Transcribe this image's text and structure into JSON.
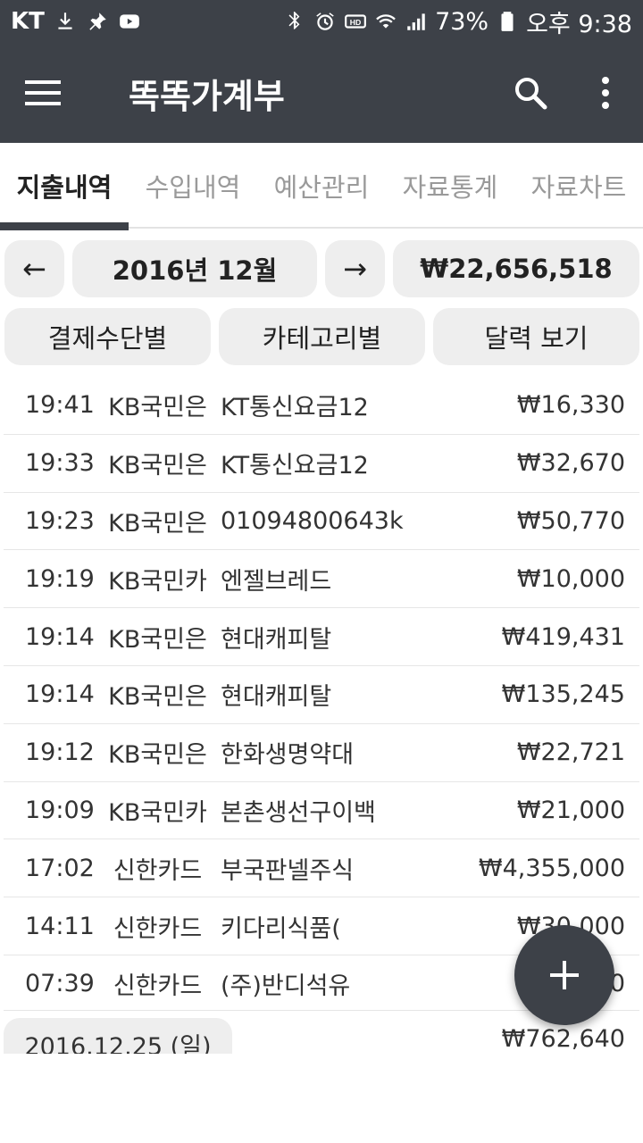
{
  "status_bar": {
    "carrier": "KT",
    "battery": "73%",
    "time": "오후 9:38",
    "icons": [
      "download-icon",
      "pin-icon",
      "youtube-icon",
      "bluetooth-icon",
      "alarm-icon",
      "hd-icon",
      "wifi-icon",
      "signal-icon",
      "battery-icon"
    ]
  },
  "appbar": {
    "title": "똑똑가계부",
    "icons": [
      "menu-icon",
      "search-icon",
      "more-vert-icon"
    ]
  },
  "tabs": [
    {
      "label": "지출내역",
      "active": true
    },
    {
      "label": "수입내역",
      "active": false
    },
    {
      "label": "예산관리",
      "active": false
    },
    {
      "label": "자료통계",
      "active": false
    },
    {
      "label": "자료차트",
      "active": false
    }
  ],
  "controls": {
    "prev": "←",
    "month": "2016년 12월",
    "next": "→",
    "total": "₩22,656,518",
    "by_payment": "결제수단별",
    "by_category": "카테고리별",
    "calendar": "달력 보기"
  },
  "transactions": [
    {
      "time": "19:41",
      "payment": "KB국민은",
      "desc": "KT통신요금12",
      "amount": "₩16,330"
    },
    {
      "time": "19:33",
      "payment": "KB국민은",
      "desc": "KT통신요금12",
      "amount": "₩32,670"
    },
    {
      "time": "19:23",
      "payment": "KB국민은",
      "desc": "01094800643k",
      "amount": "₩50,770"
    },
    {
      "time": "19:19",
      "payment": "KB국민카",
      "desc": "엔젤브레드",
      "amount": "₩10,000"
    },
    {
      "time": "19:14",
      "payment": "KB국민은",
      "desc": "현대캐피탈",
      "amount": "₩419,431"
    },
    {
      "time": "19:14",
      "payment": "KB국민은",
      "desc": "현대캐피탈",
      "amount": "₩135,245"
    },
    {
      "time": "19:12",
      "payment": "KB국민은",
      "desc": "한화생명약대",
      "amount": "₩22,721"
    },
    {
      "time": "19:09",
      "payment": "KB국민카",
      "desc": "본촌생선구이백",
      "amount": "₩21,000"
    },
    {
      "time": "17:02",
      "payment": "신한카드",
      "desc": "부국판넬주식",
      "amount": "₩4,355,000"
    },
    {
      "time": "14:11",
      "payment": "신한카드",
      "desc": "키다리식품(",
      "amount": "₩30,000"
    },
    {
      "time": "07:39",
      "payment": "신한카드",
      "desc": "(주)반디석유",
      "amount": "₩...0"
    }
  ],
  "day_summary": {
    "date": "2016.12.25 (일)",
    "total": "₩762,640"
  },
  "fab": {
    "icon": "plus-icon"
  },
  "colors": {
    "primary": "#3d4148",
    "pill": "#eeeeee",
    "inactive_tab": "#9a9a9a"
  }
}
